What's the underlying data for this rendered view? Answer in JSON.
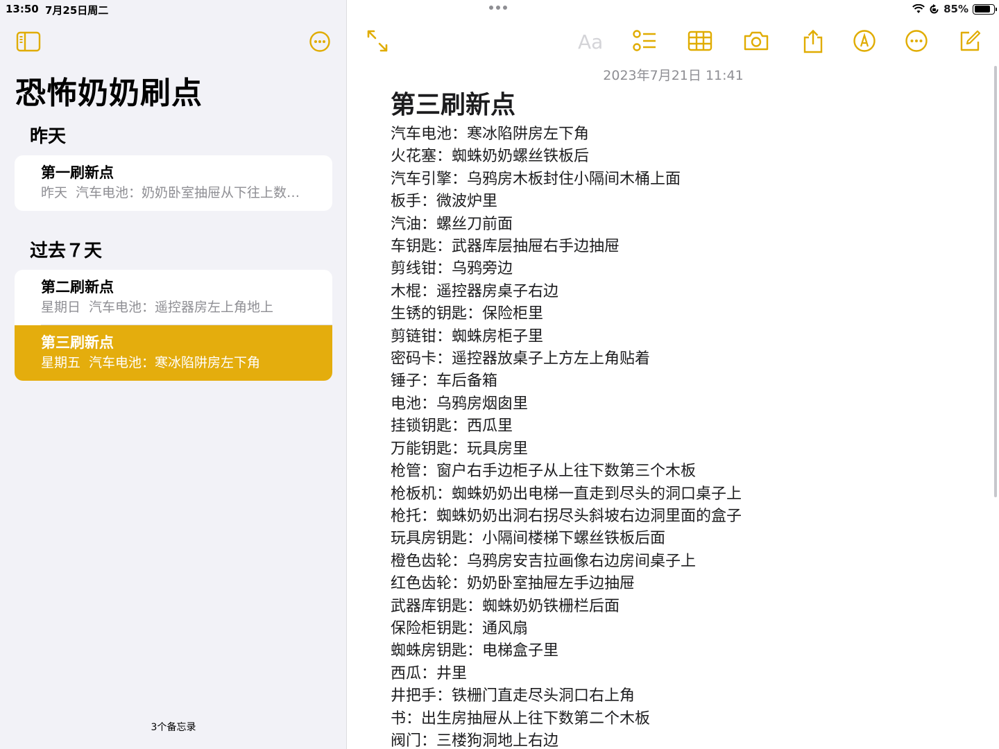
{
  "status_bar": {
    "time": "13:50",
    "date": "7月25日周二",
    "battery": "85%",
    "battery_level": 0.85
  },
  "sidebar": {
    "folder_title": "恐怖奶奶刷点",
    "sections": [
      {
        "header": "昨天",
        "notes": [
          {
            "title": "第一刷新点",
            "date": "昨天",
            "preview": "汽车电池：奶奶卧室抽屉从下往上数…"
          }
        ]
      },
      {
        "header": "过去７天",
        "notes": [
          {
            "title": "第二刷新点",
            "date": "星期日",
            "preview": "汽车电池：遥控器房左上角地上"
          },
          {
            "title": "第三刷新点",
            "date": "星期五",
            "preview": "汽车电池：寒冰陷阱房左下角",
            "selected": true
          }
        ]
      }
    ],
    "note_count": "3个备忘录"
  },
  "editor": {
    "toolbar": {
      "format_label": "Aa",
      "icons": [
        "expand-icon",
        "checklist-icon",
        "table-icon",
        "camera-icon",
        "share-icon",
        "markup-icon",
        "more-icon",
        "compose-icon"
      ]
    },
    "date": "2023年7月21日 11:41",
    "heading": "第三刷新点",
    "lines": [
      "汽车电池：寒冰陷阱房左下角",
      "火花塞：蜘蛛奶奶螺丝铁板后",
      "汽车引擎：乌鸦房木板封住小隔间木桶上面",
      "板手：微波炉里",
      "汽油：螺丝刀前面",
      "车钥匙：武器库层抽屉右手边抽屉",
      "剪线钳：乌鸦旁边",
      "木棍：遥控器房桌子右边",
      "生锈的钥匙：保险柜里",
      "剪链钳：蜘蛛房柜子里",
      "密码卡：遥控器放桌子上方左上角贴着",
      "锤子：车后备箱",
      "电池：乌鸦房烟囱里",
      "挂锁钥匙：西瓜里",
      "万能钥匙：玩具房里",
      "枪管：窗户右手边柜子从上往下数第三个木板",
      "枪板机：蜘蛛奶奶出电梯一直走到尽头的洞口桌子上",
      "枪托：蜘蛛奶奶出洞右拐尽头斜坡右边洞里面的盒子",
      "玩具房钥匙：小隔间楼梯下螺丝铁板后面",
      "橙色齿轮：乌鸦房安吉拉画像右边房间桌子上",
      "红色齿轮：奶奶卧室抽屉左手边抽屉",
      "武器库钥匙：蜘蛛奶奶铁栅栏后面",
      "保险柜钥匙：通风扇",
      "蜘蛛房钥匙：电梯盒子里",
      "西瓜：井里",
      "井把手：铁栅门直走尽头洞口右上角",
      "书：出生房抽屉从上往下数第二个木板",
      "阀门：三楼狗洞地上右边"
    ]
  },
  "colors": {
    "accent": "#e0ac00",
    "selected_row": "#e4ad0d",
    "sidebar_bg": "#f2f2f7",
    "secondary_text": "#8e8e93"
  }
}
